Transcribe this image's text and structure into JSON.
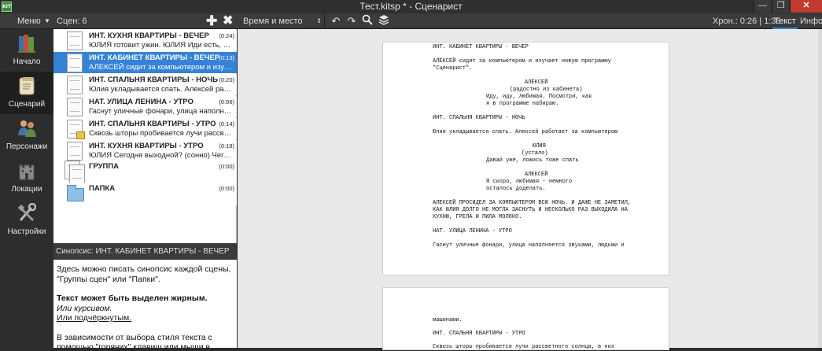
{
  "window": {
    "title": "Тест.kitsp * - Сценарист"
  },
  "menu": {
    "label": "Меню"
  },
  "scenes_panel": {
    "count_label": "Сцен: 6"
  },
  "toolbar": {
    "scene_type": "Время и место",
    "chron": "Хрон.: 0:26 | 1:35"
  },
  "tabs": {
    "text": "Текст",
    "info": "Инфо"
  },
  "sidebar": {
    "items": [
      {
        "label": "Начало",
        "icon": "books-icon"
      },
      {
        "label": "Сценарий",
        "icon": "scroll-icon"
      },
      {
        "label": "Персонажи",
        "icon": "people-icon"
      },
      {
        "label": "Локации",
        "icon": "castle-icon"
      },
      {
        "label": "Настройки",
        "icon": "tools-icon"
      }
    ]
  },
  "scenes": [
    {
      "title": "ИНТ. КУХНЯ КВАРТИРЫ - ВЕЧЕР",
      "time": "(0:24)",
      "text": "ЮЛИЯ готовит ужин. ЮЛИЯ Иди есть, всё готово"
    },
    {
      "title": "ИНТ. КАБИНЕТ КВАРТИРЫ - ВЕЧЕР",
      "time": "(0:13)",
      "text": "АЛЕКСЕЙ сидит за компьютером и изучает новую программу"
    },
    {
      "title": "ИНТ. СПАЛЬНЯ КВАРТИРЫ - НОЧЬ",
      "time": "(0:20)",
      "text": "Юлия укладывается спать. Алексей работает за компьютером"
    },
    {
      "title": "НАТ. УЛИЦА ЛЕНИНА - УТРО",
      "time": "(0:06)",
      "text": "Гаснут уличные фонари, улица наполняется звуками"
    },
    {
      "title": "ИНТ. СПАЛЬНЯ КВАРТИРЫ - УТРО",
      "time": "(0:14)",
      "text": "Сквозь шторы пробивается лучи рассветного солнца"
    },
    {
      "title": "ИНТ. КУХНЯ КВАРТИРЫ - УТРО",
      "time": "(0:18)",
      "text": "ЮЛИЯ Сегодня выходной? (сонно) Чего так рано"
    },
    {
      "title": "ГРУППА",
      "time": "(0:00)",
      "text": ""
    },
    {
      "title": "ПАПКА",
      "time": "(0:00)",
      "text": ""
    }
  ],
  "synopsis": {
    "header": "Синопсис: ИНТ. КАБИНЕТ КВАРТИРЫ - ВЕЧЕР",
    "p1": "Здесь можно писать синопсис каждой сцены, \"Группы сцен\" или \"Папки\".",
    "bold": "Текст может быть выделен жирным.",
    "italic": "Или курсивом.",
    "underline": "Или подчёркнутым.",
    "p2": "В зависимости от выбора стиля текста с помощью \"горячих\" клавиш или мыши в"
  },
  "script": {
    "l1": "ИНТ. КАБИНЕТ КВАРТИРЫ - ВЕЧЕР",
    "l2": "АЛЕКСЕЙ сидит за компьютером и изучает новую программу",
    "l3": "\"Сценарист\".",
    "l4": "АЛЕКСЕЙ",
    "l5": "(радостно из кабинета)",
    "l6": "Иду, иду, любимая. Посмотри, как",
    "l7": "я в программе набираю.",
    "l8": "ИНТ. СПАЛЬНЯ КВАРТИРЫ - НОЧЬ",
    "l9": "Юлия укладывается спать. Алексей работает за компьютером",
    "l10": "ЮЛИЯ",
    "l11": "(устало)",
    "l12": "Давай уже, ложись тоже спать",
    "l13": "АЛЕКСЕЙ",
    "l14": "Я скоро, любимая - немного",
    "l15": "осталось доделать.",
    "l16": "АЛЕКСЕЙ ПРОСИДЕЛ ЗА КОМПЬЮТЕРОМ ВСЮ НОЧЬ. И ДАЖЕ НЕ ЗАМЕТИЛ,",
    "l17": "КАК ЮЛИЯ ДОЛГО НЕ МОГЛА ЗАСНУТЬ И НЕСКОЛЬКО РАЗ ВЫХОДИЛА НА",
    "l18": "КУХНЮ, ГРЕЛА И ПИЛА МОЛОКО.",
    "l19": "НАТ. УЛИЦА ЛЕНИНА - УТРО",
    "l20": "Гаснут уличные фонари, улица наполняется звуками, людьми и",
    "p2l1": "машинами.",
    "p2l2": "ИНТ. СПАЛЬНЯ КВАРТИРЫ - УТРО",
    "p2l3": "Сквозь шторы пробивается лучи рассветного солнца, в них"
  }
}
